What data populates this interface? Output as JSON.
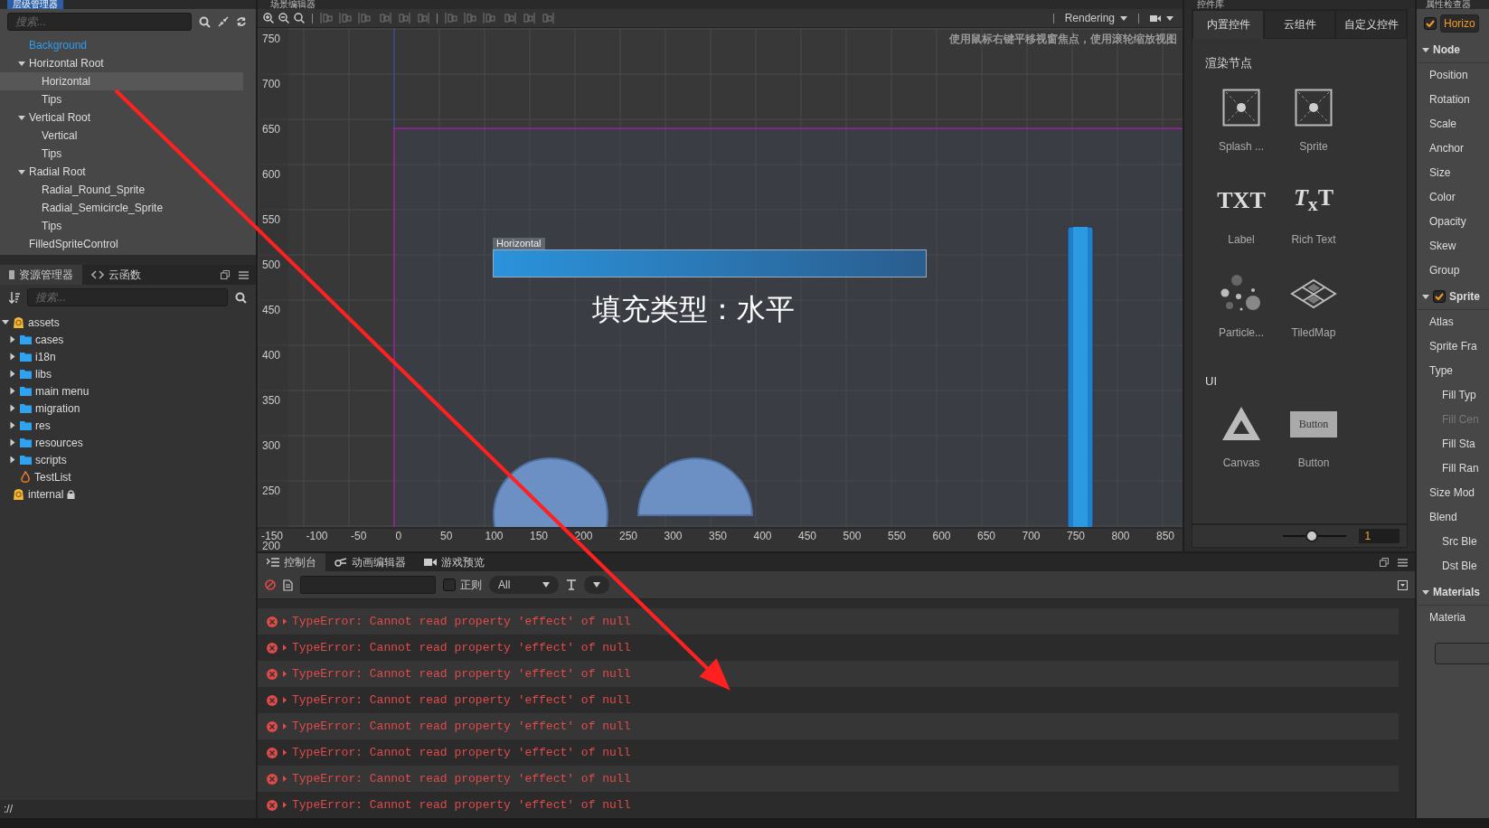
{
  "hierarchy": {
    "title": "层级管理器",
    "search": {
      "placeholder": "搜索..."
    },
    "nodes": [
      {
        "label": "Background",
        "kind": "prefab",
        "selected": false
      },
      {
        "label": "Horizontal Root",
        "kind": "node",
        "selected": false,
        "expanded": true,
        "children": [
          {
            "label": "Horizontal",
            "kind": "node",
            "selected": true
          },
          {
            "label": "Tips",
            "kind": "node",
            "selected": false
          }
        ]
      },
      {
        "label": "Vertical Root",
        "kind": "node",
        "selected": false,
        "expanded": true,
        "children": [
          {
            "label": "Vertical",
            "kind": "node",
            "selected": false
          },
          {
            "label": "Tips",
            "kind": "node",
            "selected": false
          }
        ]
      },
      {
        "label": "Radial Root",
        "kind": "node",
        "selected": false,
        "expanded": true,
        "children": [
          {
            "label": "Radial_Round_Sprite",
            "kind": "node",
            "selected": false
          },
          {
            "label": "Radial_Semicircle_Sprite",
            "kind": "node",
            "selected": false
          },
          {
            "label": "Tips",
            "kind": "node",
            "selected": false
          }
        ]
      },
      {
        "label": "FilledSpriteControl",
        "kind": "node",
        "selected": false
      }
    ]
  },
  "assets": {
    "tabs": [
      {
        "label": "资源管理器",
        "selected": true
      },
      {
        "label": "云函数",
        "selected": false
      }
    ],
    "search": {
      "placeholder": "搜索..."
    },
    "items": [
      {
        "label": "assets",
        "kind": "db",
        "locked": false,
        "expanded": true,
        "children": [
          {
            "label": "cases",
            "kind": "folder",
            "expanded": false
          },
          {
            "label": "i18n",
            "kind": "folder",
            "expanded": false
          },
          {
            "label": "libs",
            "kind": "folder",
            "expanded": false
          },
          {
            "label": "main menu",
            "kind": "folder",
            "expanded": false
          },
          {
            "label": "migration",
            "kind": "folder",
            "expanded": false
          },
          {
            "label": "res",
            "kind": "folder",
            "expanded": false
          },
          {
            "label": "resources",
            "kind": "folder",
            "expanded": false
          },
          {
            "label": "scripts",
            "kind": "folder",
            "expanded": false
          },
          {
            "label": "TestList",
            "kind": "scene"
          }
        ]
      },
      {
        "label": "internal",
        "kind": "db",
        "locked": true
      }
    ],
    "status": "://"
  },
  "scene": {
    "title": "场景编辑器",
    "mode": "Rendering",
    "hint": "使用鼠标右键平移视窗焦点，使用滚轮缩放视图",
    "y_ruler": [
      "750",
      "700",
      "650",
      "600",
      "550",
      "500",
      "450",
      "400",
      "350",
      "300",
      "250",
      "200"
    ],
    "x_ruler": [
      "-150",
      "-100",
      "-50",
      "0",
      "50",
      "100",
      "150",
      "200",
      "250",
      "300",
      "350",
      "400",
      "450",
      "500",
      "550",
      "600",
      "650",
      "700",
      "750",
      "800",
      "850"
    ],
    "bar_label": "Horizontal",
    "caption": "填充类型：水平"
  },
  "widgets": {
    "title": "控件库",
    "tabs": [
      {
        "label": "内置控件",
        "selected": true
      },
      {
        "label": "云组件",
        "selected": false
      },
      {
        "label": "自定义控件",
        "selected": false
      }
    ],
    "sections": [
      {
        "title": "渲染节点",
        "items": [
          {
            "label": "Splash ...",
            "kind": "sprite"
          },
          {
            "label": "Sprite",
            "kind": "sprite"
          },
          {
            "label": "Label",
            "kind": "text",
            "icon_text": "TXT"
          },
          {
            "label": "Rich Text",
            "kind": "text",
            "icon_text": "*T*$_{x}$T"
          },
          {
            "label": "Particle...",
            "kind": "particle"
          },
          {
            "label": "TiledMap",
            "kind": "tiledmap"
          }
        ]
      },
      {
        "title": "UI",
        "items": [
          {
            "label": "Canvas",
            "kind": "canvas"
          },
          {
            "label": "Button",
            "kind": "button",
            "icon_text": "Button"
          }
        ]
      }
    ],
    "zoom": {
      "level": 0.45,
      "value": "1"
    }
  },
  "inspector": {
    "title": "属性检查器",
    "node_enabled": true,
    "node_name": "Horizo",
    "sections": [
      {
        "title": "Node",
        "expanded": true,
        "props": [
          {
            "label": "Position",
            "disabled": false
          },
          {
            "label": "Rotation",
            "disabled": false
          },
          {
            "label": "Scale",
            "disabled": false
          },
          {
            "label": "Anchor",
            "disabled": false
          },
          {
            "label": "Size",
            "disabled": false
          },
          {
            "label": "Color",
            "disabled": false
          },
          {
            "label": "Opacity",
            "disabled": false
          },
          {
            "label": "Skew",
            "disabled": false
          },
          {
            "label": "Group",
            "disabled": false
          }
        ]
      },
      {
        "title": "Sprite",
        "expanded": true,
        "enabled": true,
        "props": [
          {
            "label": "Atlas",
            "disabled": false
          },
          {
            "label": "Sprite Fra",
            "disabled": false
          },
          {
            "label": "Type",
            "disabled": false,
            "children": [
              {
                "label": "Fill Typ",
                "disabled": false
              },
              {
                "label": "Fill Cen",
                "disabled": true
              },
              {
                "label": "Fill Sta",
                "disabled": false
              },
              {
                "label": "Fill Ran",
                "disabled": false
              }
            ]
          },
          {
            "label": "Size Mod",
            "disabled": false
          },
          {
            "label": "Blend",
            "disabled": false,
            "children": [
              {
                "label": "Src Ble",
                "disabled": false
              },
              {
                "label": "Dst Ble",
                "disabled": false
              }
            ]
          }
        ]
      },
      {
        "title": "Materials",
        "expanded": true,
        "props": [
          {
            "label": "Materia",
            "disabled": false
          }
        ]
      }
    ]
  },
  "console": {
    "tabs": [
      {
        "label": "控制台",
        "selected": true
      },
      {
        "label": "动画编辑器",
        "selected": false
      },
      {
        "label": "游戏预览",
        "selected": false
      }
    ],
    "regex": {
      "label": "正则",
      "checked": false
    },
    "level_filter": "All",
    "messages": [
      {
        "kind": "error",
        "text": "TypeError: Cannot read property 'effect' of null"
      },
      {
        "kind": "error",
        "text": "TypeError: Cannot read property 'effect' of null"
      },
      {
        "kind": "error",
        "text": "TypeError: Cannot read property 'effect' of null"
      },
      {
        "kind": "error",
        "text": "TypeError: Cannot read property 'effect' of null"
      },
      {
        "kind": "error",
        "text": "TypeError: Cannot read property 'effect' of null"
      },
      {
        "kind": "error",
        "text": "TypeError: Cannot read property 'effect' of null"
      },
      {
        "kind": "error",
        "text": "TypeError: Cannot read property 'effect' of null"
      },
      {
        "kind": "error",
        "text": "TypeError: Cannot read property 'effect' of null"
      }
    ]
  }
}
